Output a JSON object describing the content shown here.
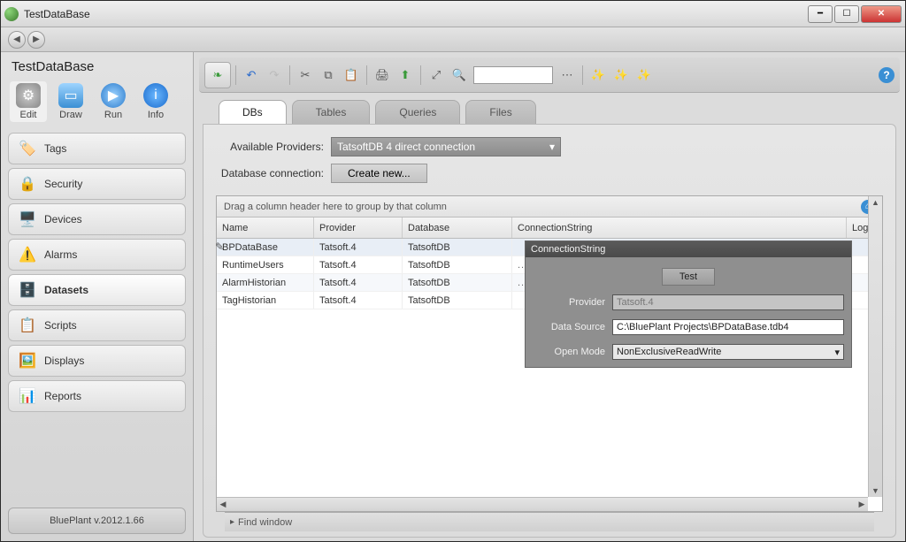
{
  "window": {
    "title": "TestDataBase"
  },
  "sidebar": {
    "project_title": "TestDataBase",
    "tools": [
      {
        "id": "edit",
        "label": "Edit"
      },
      {
        "id": "draw",
        "label": "Draw"
      },
      {
        "id": "run",
        "label": "Run"
      },
      {
        "id": "info",
        "label": "Info"
      }
    ],
    "items": [
      {
        "id": "tags",
        "label": "Tags",
        "icon": "🏷️"
      },
      {
        "id": "security",
        "label": "Security",
        "icon": "🔒"
      },
      {
        "id": "devices",
        "label": "Devices",
        "icon": "🖥️"
      },
      {
        "id": "alarms",
        "label": "Alarms",
        "icon": "⚠️"
      },
      {
        "id": "datasets",
        "label": "Datasets",
        "icon": "🗄️"
      },
      {
        "id": "scripts",
        "label": "Scripts",
        "icon": "📋"
      },
      {
        "id": "displays",
        "label": "Displays",
        "icon": "🖼️"
      },
      {
        "id": "reports",
        "label": "Reports",
        "icon": "📊"
      }
    ],
    "footer": "BluePlant  v.2012.1.66"
  },
  "tabs": [
    {
      "id": "dbs",
      "label": "DBs"
    },
    {
      "id": "tables",
      "label": "Tables"
    },
    {
      "id": "queries",
      "label": "Queries"
    },
    {
      "id": "files",
      "label": "Files"
    }
  ],
  "form": {
    "providers_label": "Available Providers:",
    "providers_value": "TatsoftDB 4 direct connection",
    "connection_label": "Database connection:",
    "create_btn": "Create new..."
  },
  "grid": {
    "group_hint": "Drag a column header here to group by that column",
    "columns": {
      "name": "Name",
      "provider": "Provider",
      "database": "Database",
      "conn": "ConnectionString",
      "logo": "LogonName"
    },
    "rows": [
      {
        "name": "BPDataBase",
        "provider": "Tatsoft.4",
        "database": "TatsoftDB"
      },
      {
        "name": "RuntimeUsers",
        "provider": "Tatsoft.4",
        "database": "TatsoftDB"
      },
      {
        "name": "AlarmHistorian",
        "provider": "Tatsoft.4",
        "database": "TatsoftDB"
      },
      {
        "name": "TagHistorian",
        "provider": "Tatsoft.4",
        "database": "TatsoftDB"
      }
    ]
  },
  "popup": {
    "title": "ConnectionString",
    "test_btn": "Test",
    "provider_label": "Provider",
    "provider_value": "Tatsoft.4",
    "datasource_label": "Data Source",
    "datasource_value": "C:\\BluePlant Projects\\BPDataBase.tdb4",
    "openmode_label": "Open Mode",
    "openmode_value": "NonExclusiveReadWrite"
  },
  "findbar": {
    "label": "Find window"
  }
}
